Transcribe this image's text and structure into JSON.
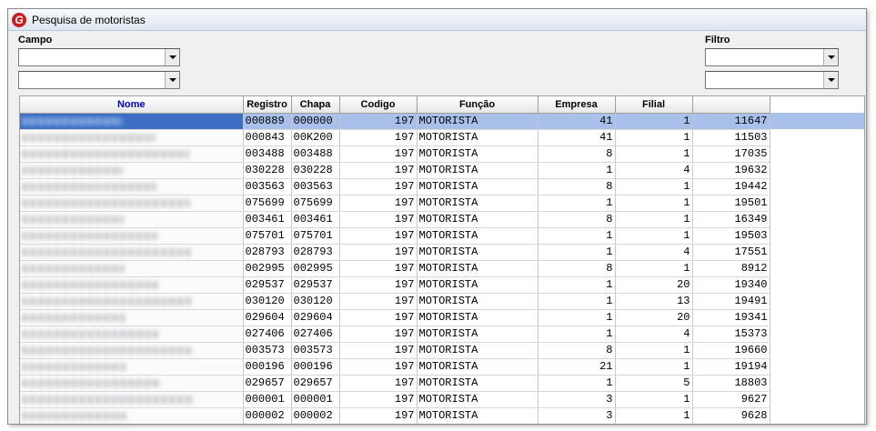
{
  "window": {
    "title": "Pesquisa de motoristas"
  },
  "filters": {
    "campo_label": "Campo",
    "filtro_label": "Filtro",
    "campo1_value": "",
    "campo2_value": "",
    "filtro1_value": "",
    "filtro2_value": ""
  },
  "grid": {
    "headers": [
      "Nome",
      "Registro",
      "Chapa",
      "Codigo",
      "Função",
      "Empresa",
      "Filial",
      ""
    ],
    "rows": [
      {
        "registro": "000889",
        "chapa": "000000",
        "codigo": "197",
        "funcao": "MOTORISTA",
        "empresa": "41",
        "filial": "1",
        "id": "11647"
      },
      {
        "registro": "000843",
        "chapa": "00K200",
        "codigo": "197",
        "funcao": "MOTORISTA",
        "empresa": "41",
        "filial": "1",
        "id": "11503"
      },
      {
        "registro": "003488",
        "chapa": "003488",
        "codigo": "197",
        "funcao": "MOTORISTA",
        "empresa": "8",
        "filial": "1",
        "id": "17035"
      },
      {
        "registro": "030228",
        "chapa": "030228",
        "codigo": "197",
        "funcao": "MOTORISTA",
        "empresa": "1",
        "filial": "4",
        "id": "19632"
      },
      {
        "registro": "003563",
        "chapa": "003563",
        "codigo": "197",
        "funcao": "MOTORISTA",
        "empresa": "8",
        "filial": "1",
        "id": "19442"
      },
      {
        "registro": "075699",
        "chapa": "075699",
        "codigo": "197",
        "funcao": "MOTORISTA",
        "empresa": "1",
        "filial": "1",
        "id": "19501"
      },
      {
        "registro": "003461",
        "chapa": "003461",
        "codigo": "197",
        "funcao": "MOTORISTA",
        "empresa": "8",
        "filial": "1",
        "id": "16349"
      },
      {
        "registro": "075701",
        "chapa": "075701",
        "codigo": "197",
        "funcao": "MOTORISTA",
        "empresa": "1",
        "filial": "1",
        "id": "19503"
      },
      {
        "registro": "028793",
        "chapa": "028793",
        "codigo": "197",
        "funcao": "MOTORISTA",
        "empresa": "1",
        "filial": "4",
        "id": "17551"
      },
      {
        "registro": "002995",
        "chapa": "002995",
        "codigo": "197",
        "funcao": "MOTORISTA",
        "empresa": "8",
        "filial": "1",
        "id": "8912"
      },
      {
        "registro": "029537",
        "chapa": "029537",
        "codigo": "197",
        "funcao": "MOTORISTA",
        "empresa": "1",
        "filial": "20",
        "id": "19340"
      },
      {
        "registro": "030120",
        "chapa": "030120",
        "codigo": "197",
        "funcao": "MOTORISTA",
        "empresa": "1",
        "filial": "13",
        "id": "19491"
      },
      {
        "registro": "029604",
        "chapa": "029604",
        "codigo": "197",
        "funcao": "MOTORISTA",
        "empresa": "1",
        "filial": "20",
        "id": "19341"
      },
      {
        "registro": "027406",
        "chapa": "027406",
        "codigo": "197",
        "funcao": "MOTORISTA",
        "empresa": "1",
        "filial": "4",
        "id": "15373"
      },
      {
        "registro": "003573",
        "chapa": "003573",
        "codigo": "197",
        "funcao": "MOTORISTA",
        "empresa": "8",
        "filial": "1",
        "id": "19660"
      },
      {
        "registro": "000196",
        "chapa": "000196",
        "codigo": "197",
        "funcao": "MOTORISTA",
        "empresa": "21",
        "filial": "1",
        "id": "19194"
      },
      {
        "registro": "029657",
        "chapa": "029657",
        "codigo": "197",
        "funcao": "MOTORISTA",
        "empresa": "1",
        "filial": "5",
        "id": "18803"
      },
      {
        "registro": "000001",
        "chapa": "000001",
        "codigo": "197",
        "funcao": "MOTORISTA",
        "empresa": "3",
        "filial": "1",
        "id": "9627"
      },
      {
        "registro": "000002",
        "chapa": "000002",
        "codigo": "197",
        "funcao": "MOTORISTA",
        "empresa": "3",
        "filial": "1",
        "id": "9628"
      }
    ]
  },
  "colors": {
    "selected_row": "#a9c1ea",
    "selected_name": "#3c6fc4",
    "nome_header": "#0000c0"
  }
}
